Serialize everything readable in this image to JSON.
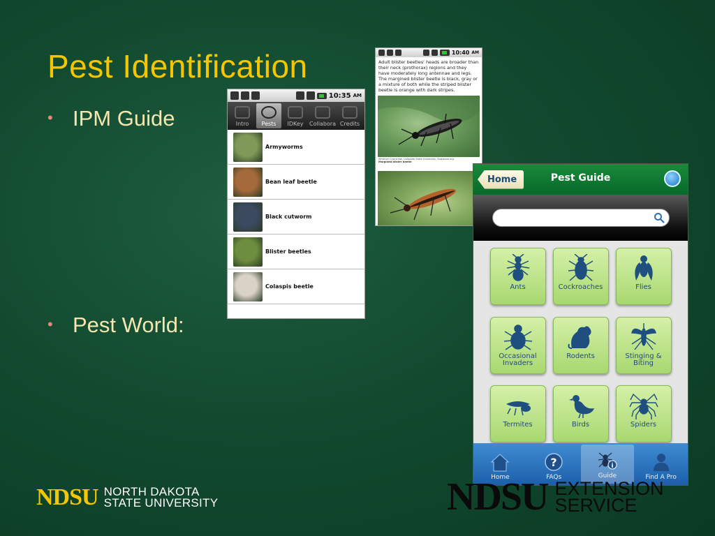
{
  "slide": {
    "title": "Pest Identification",
    "bullets": [
      "IPM Guide",
      "Pest World:"
    ]
  },
  "ipm_list_screen": {
    "status_time": "10:35",
    "status_ampm": "AM",
    "tabs": [
      "Intro",
      "Pests",
      "IDKey",
      "Collabora",
      "Credits"
    ],
    "active_tab": "Pests",
    "items": [
      {
        "name": "Armyworms",
        "thumb_color": "#7f9a58"
      },
      {
        "name": "Bean leaf beetle",
        "thumb_color": "#a56a3c"
      },
      {
        "name": "Black cutworm",
        "thumb_color": "#3b4a5f"
      },
      {
        "name": "Blister beetles",
        "thumb_color": "#6d8e3e"
      },
      {
        "name": "Colaspis beetle",
        "thumb_color": "#d9d2c6"
      }
    ]
  },
  "detail_screen": {
    "status_time": "10:40",
    "status_ampm": "AM",
    "description": "Adult blister beetles' heads are broader than their neck (prothorax) regions and they have moderately long antennae and legs. The margined blister beetle is black, gray or a mixture of both while the striped blister beetle is orange with dark stripes.",
    "photo_credit": "Whitney Cranshaw, Colorado State University, Bugwood.org",
    "photo_caption": "Margined blister beetle"
  },
  "pest_world_app": {
    "home_button": "Home",
    "title": "Pest Guide",
    "search_placeholder": "",
    "categories": [
      {
        "label": "Ants",
        "icon": "ant-icon"
      },
      {
        "label": "Cockroaches",
        "icon": "cockroach-icon"
      },
      {
        "label": "Flies",
        "icon": "fly-icon"
      },
      {
        "label": "Occasional Invaders",
        "icon": "beetle-icon"
      },
      {
        "label": "Rodents",
        "icon": "rodent-icon"
      },
      {
        "label": "Stinging & Biting",
        "icon": "mosquito-icon"
      },
      {
        "label": "Termites",
        "icon": "termite-icon"
      },
      {
        "label": "Birds",
        "icon": "bird-icon"
      },
      {
        "label": "Spiders",
        "icon": "spider-icon"
      }
    ],
    "nav": [
      {
        "label": "Home",
        "icon": "house-icon"
      },
      {
        "label": "FAQs",
        "icon": "question-icon"
      },
      {
        "label": "Guide",
        "icon": "guide-icon"
      },
      {
        "label": "Find A Pro",
        "icon": "person-icon"
      }
    ],
    "active_nav": "Guide"
  },
  "logos": {
    "left_mark": "NDSU",
    "left_sub_line1": "NORTH DAKOTA",
    "left_sub_line2": "STATE UNIVERSITY",
    "right_mark": "NDSU",
    "right_sub_line1": "EXTENSION",
    "right_sub_line2": "SERVICE"
  },
  "colors": {
    "title": "#f3c600",
    "bullet_text": "#f3e7b0",
    "app_header_green": "#1b8a3a",
    "tile_green": "#a8d870",
    "nav_blue": "#2f78c4"
  }
}
